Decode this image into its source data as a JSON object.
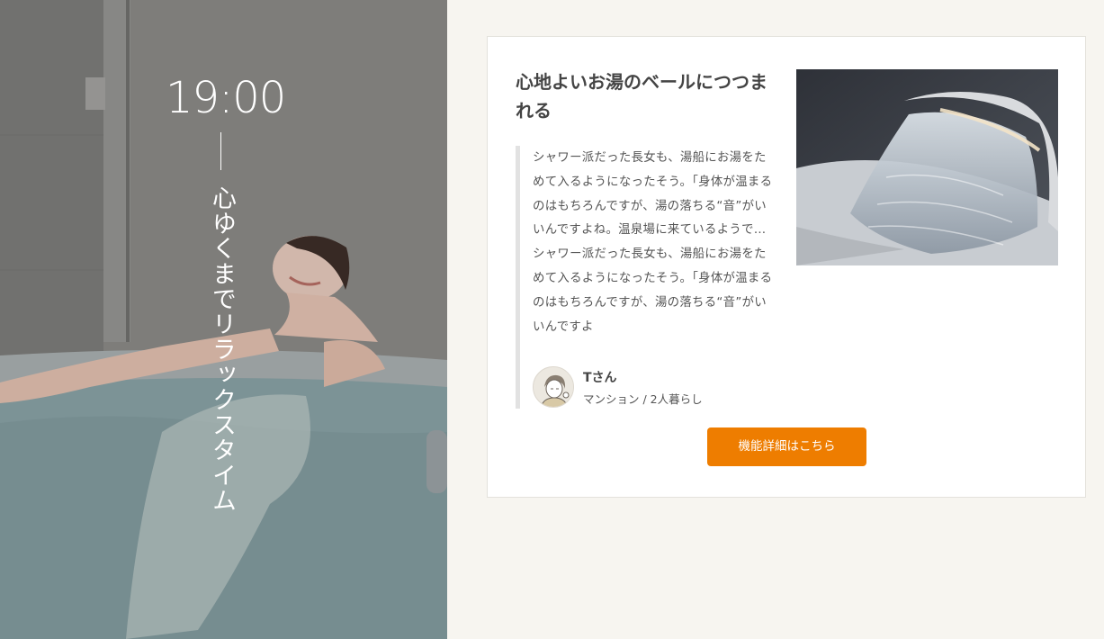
{
  "hero": {
    "time": "19:00",
    "title": "心ゆくまでリラックスタイム"
  },
  "card": {
    "headline": "心地よいお湯のベールにつつまれる",
    "quote": "シャワー派だった長女も、湯船にお湯をためて入るようになったそう。「身体が温まるのはもちろんですが、湯の落ちる“音”がいいんですよね。温泉場に来ているようで…シャワー派だった長女も、湯船にお湯をためて入るようになったそう。「身体が温まるのはもちろんですが、湯の落ちる“音”がいいんですよ",
    "reviewer": {
      "name": "Tさん",
      "meta": "マンション / 2人暮らし"
    },
    "button_label": "機能詳細はこちら"
  },
  "colors": {
    "accent": "#ee7d00",
    "page_background": "#f7f5f0",
    "card_background": "#ffffff",
    "quote_bar": "#e2e2e2"
  },
  "icons": {
    "reviewer_avatar": "person-illustration-icon"
  }
}
